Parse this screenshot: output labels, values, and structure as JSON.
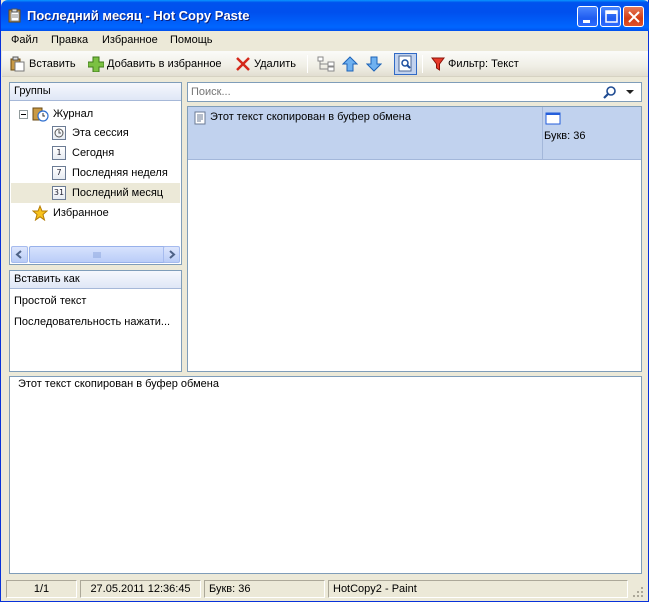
{
  "window": {
    "title": "Последний месяц - Hot Copy Paste"
  },
  "menu": [
    "Файл",
    "Правка",
    "Избранное",
    "Помощь"
  ],
  "toolbar": {
    "paste": "Вставить",
    "add_favorite": "Добавить в избранное",
    "delete": "Удалить",
    "filter": "Фильтр: Текст"
  },
  "groups": {
    "header": "Группы",
    "journal": "Журнал",
    "session": "Эта сессия",
    "today": "Сегодня",
    "today_badge": "1",
    "week": "Последняя неделя",
    "week_badge": "7",
    "month": "Последний месяц",
    "month_badge": "31",
    "favorites": "Избранное"
  },
  "paste_as": {
    "header": "Вставить как",
    "options": [
      "Простой текст",
      "Последовательность нажати..."
    ]
  },
  "search": {
    "placeholder": "Поиск..."
  },
  "clip_list": {
    "items": [
      {
        "text": "Этот текст скопирован в буфер обмена",
        "info": "Букв: 36"
      }
    ]
  },
  "preview": {
    "text": "Этот текст скопирован в буфер обмена"
  },
  "status": {
    "position": "1/1",
    "datetime": "27.05.2011 12:36:45",
    "letters": "Букв: 36",
    "source": "HotCopy2 - Paint"
  },
  "colors": {
    "titlebar": "#0053ee",
    "selection": "#c1d2ee",
    "border": "#7f9db9"
  }
}
